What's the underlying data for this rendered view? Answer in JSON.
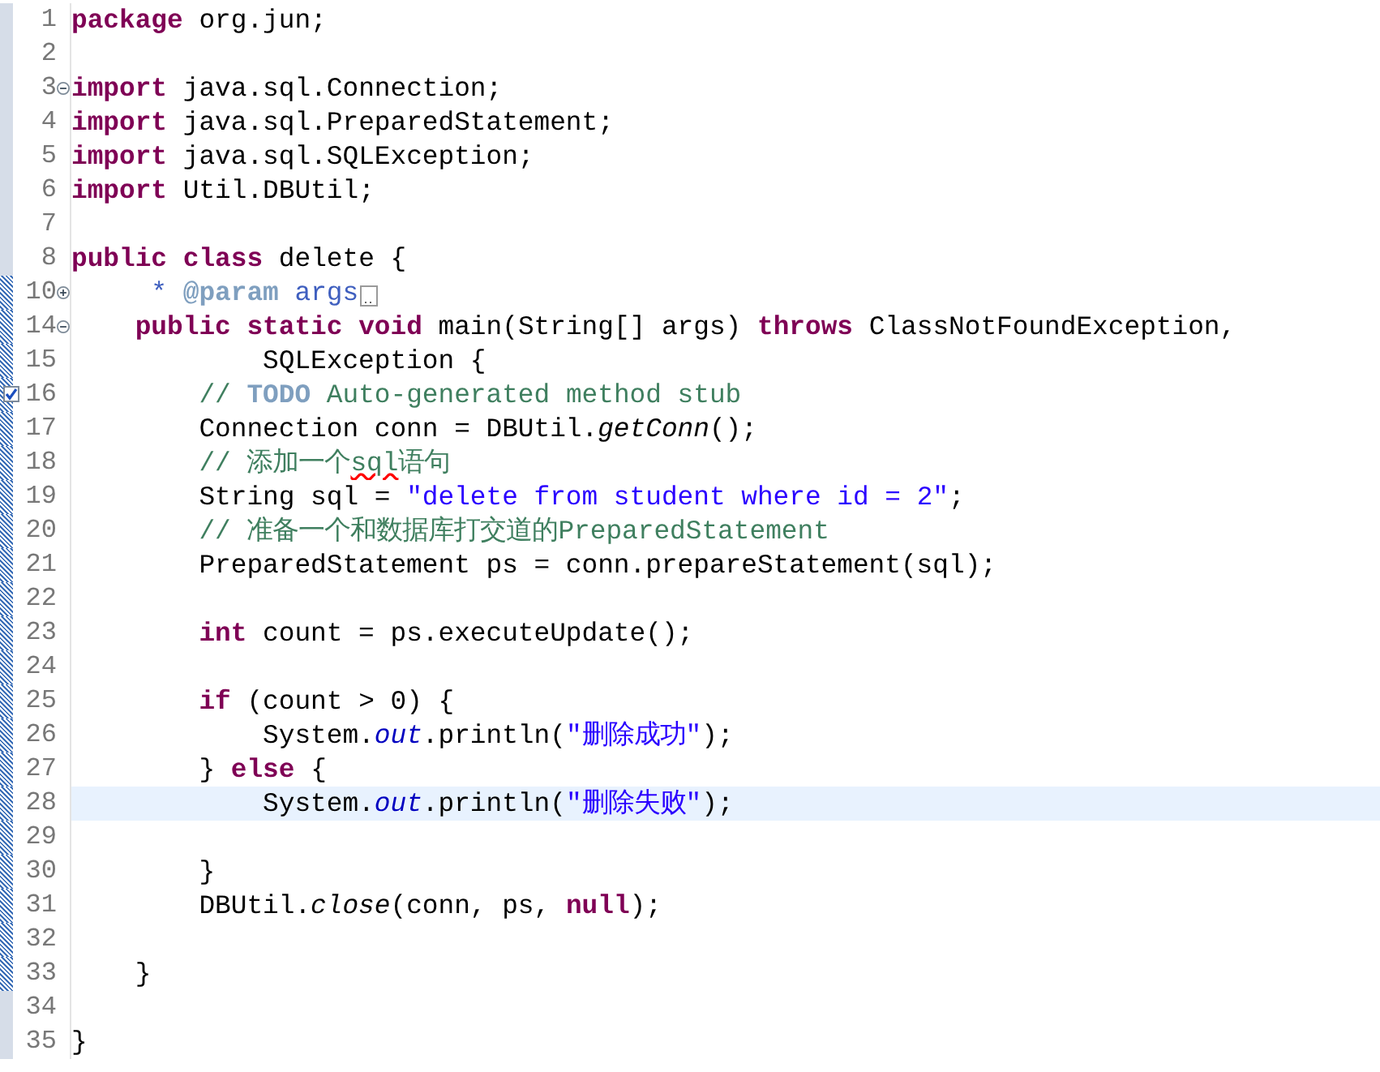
{
  "editor": {
    "lines": [
      {
        "number": "1",
        "current": false,
        "in_range": false,
        "tokens": [
          {
            "kind": "kw",
            "text": "package"
          },
          {
            "kind": "plain",
            "text": " org.jun;"
          }
        ]
      },
      {
        "number": "2",
        "current": false,
        "in_range": false
      },
      {
        "number": "3",
        "current": false,
        "in_range": false,
        "expanded": true,
        "tokens": [
          {
            "kind": "kw",
            "text": "import"
          },
          {
            "kind": "plain",
            "text": " java.sql.Connection;"
          }
        ]
      },
      {
        "number": "4",
        "current": false,
        "in_range": false,
        "tokens": [
          {
            "kind": "kw",
            "text": "import"
          },
          {
            "kind": "plain",
            "text": " java.sql.PreparedStatement;"
          }
        ]
      },
      {
        "number": "5",
        "current": false,
        "in_range": false,
        "tokens": [
          {
            "kind": "kw",
            "text": "import"
          },
          {
            "kind": "plain",
            "text": " java.sql.SQLException;"
          }
        ]
      },
      {
        "number": "6",
        "current": false,
        "in_range": false,
        "tokens": [
          {
            "kind": "kw",
            "text": "import"
          },
          {
            "kind": "plain",
            "text": " Util.DBUtil;"
          }
        ]
      },
      {
        "number": "7",
        "current": false,
        "in_range": false
      },
      {
        "number": "8",
        "current": false,
        "in_range": false,
        "tokens": [
          {
            "kind": "kw",
            "text": "public"
          },
          {
            "kind": "kw",
            "text": " class"
          },
          {
            "kind": "plain",
            "text": " delete {"
          }
        ]
      },
      {
        "number": "10",
        "current": false,
        "in_range": true,
        "expanded": false,
        "folded_body": true,
        "tokens": [
          {
            "kind": "doc",
            "text": "     * "
          },
          {
            "kind": "doc-tag",
            "text": "@param"
          },
          {
            "kind": "doc",
            "text": " args"
          }
        ]
      },
      {
        "number": "14",
        "current": false,
        "in_range": true,
        "expanded": true,
        "tokens": [
          {
            "kind": "kw",
            "text": "    public"
          },
          {
            "kind": "kw",
            "text": " static"
          },
          {
            "kind": "kw",
            "text": " void"
          },
          {
            "kind": "plain",
            "text": " main(String[] args) "
          },
          {
            "kind": "kw",
            "text": "throws"
          },
          {
            "kind": "plain",
            "text": " ClassNotFoundException,"
          }
        ]
      },
      {
        "number": "15",
        "current": false,
        "in_range": true,
        "tokens": [
          {
            "kind": "plain",
            "text": "            SQLException {"
          }
        ]
      },
      {
        "number": "16",
        "current": false,
        "in_range": true,
        "task": true,
        "tokens": [
          {
            "kind": "comment",
            "text": "        // "
          },
          {
            "kind": "todo",
            "text": "TODO"
          },
          {
            "kind": "comment",
            "text": " Auto-generated method stub"
          }
        ]
      },
      {
        "number": "17",
        "current": false,
        "in_range": true,
        "tokens": [
          {
            "kind": "plain",
            "text": "        Connection conn = DBUtil."
          },
          {
            "kind": "method",
            "text": "getConn"
          },
          {
            "kind": "plain",
            "text": "();"
          }
        ]
      },
      {
        "number": "18",
        "current": false,
        "in_range": true,
        "tokens": [
          {
            "kind": "comment",
            "text": "        // 添加一个"
          },
          {
            "kind": "misspelled",
            "text": "sql"
          },
          {
            "kind": "comment",
            "text": "语句"
          }
        ]
      },
      {
        "number": "19",
        "current": false,
        "in_range": true,
        "tokens": [
          {
            "kind": "plain",
            "text": "        String sql = "
          },
          {
            "kind": "string",
            "text": "\"delete from student where id = 2\""
          },
          {
            "kind": "plain",
            "text": ";"
          }
        ]
      },
      {
        "number": "20",
        "current": false,
        "in_range": true,
        "tokens": [
          {
            "kind": "comment",
            "text": "        // 准备一个和数据库打交道的PreparedStatement"
          }
        ]
      },
      {
        "number": "21",
        "current": false,
        "in_range": true,
        "tokens": [
          {
            "kind": "plain",
            "text": "        PreparedStatement ps = conn.prepareStatement(sql);"
          }
        ]
      },
      {
        "number": "22",
        "current": false,
        "in_range": true
      },
      {
        "number": "23",
        "current": false,
        "in_range": true,
        "tokens": [
          {
            "kind": "kw",
            "text": "        int"
          },
          {
            "kind": "plain",
            "text": " count = ps.executeUpdate();"
          }
        ]
      },
      {
        "number": "24",
        "current": false,
        "in_range": true
      },
      {
        "number": "25",
        "current": false,
        "in_range": true,
        "tokens": [
          {
            "kind": "kw",
            "text": "        if"
          },
          {
            "kind": "plain",
            "text": " (count > 0) {"
          }
        ]
      },
      {
        "number": "26",
        "current": false,
        "in_range": true,
        "tokens": [
          {
            "kind": "plain",
            "text": "            System."
          },
          {
            "kind": "field",
            "text": "out"
          },
          {
            "kind": "plain",
            "text": ".println("
          },
          {
            "kind": "string",
            "text": "\"删除成功\""
          },
          {
            "kind": "plain",
            "text": ");"
          }
        ]
      },
      {
        "number": "27",
        "current": false,
        "in_range": true,
        "tokens": [
          {
            "kind": "plain",
            "text": "        } "
          },
          {
            "kind": "kw",
            "text": "else"
          },
          {
            "kind": "plain",
            "text": " {"
          }
        ]
      },
      {
        "number": "28",
        "current": true,
        "in_range": true,
        "tokens": [
          {
            "kind": "plain",
            "text": "            System."
          },
          {
            "kind": "field",
            "text": "out"
          },
          {
            "kind": "plain",
            "text": ".println("
          },
          {
            "kind": "string",
            "text": "\"删除失败\""
          },
          {
            "kind": "plain",
            "text": ");"
          }
        ]
      },
      {
        "number": "29",
        "current": false,
        "in_range": true
      },
      {
        "number": "30",
        "current": false,
        "in_range": true,
        "tokens": [
          {
            "kind": "plain",
            "text": "        }"
          }
        ]
      },
      {
        "number": "31",
        "current": false,
        "in_range": true,
        "tokens": [
          {
            "kind": "plain",
            "text": "        DBUtil."
          },
          {
            "kind": "method",
            "text": "close"
          },
          {
            "kind": "plain",
            "text": "(conn, ps, "
          },
          {
            "kind": "kw",
            "text": "null"
          },
          {
            "kind": "plain",
            "text": ");"
          }
        ]
      },
      {
        "number": "32",
        "current": false,
        "in_range": true
      },
      {
        "number": "33",
        "current": false,
        "in_range": true,
        "tokens": [
          {
            "kind": "plain",
            "text": "    }"
          }
        ]
      },
      {
        "number": "34",
        "current": false,
        "in_range": false
      },
      {
        "number": "35",
        "current": false,
        "in_range": false,
        "tokens": [
          {
            "kind": "plain",
            "text": "}"
          }
        ]
      }
    ]
  }
}
